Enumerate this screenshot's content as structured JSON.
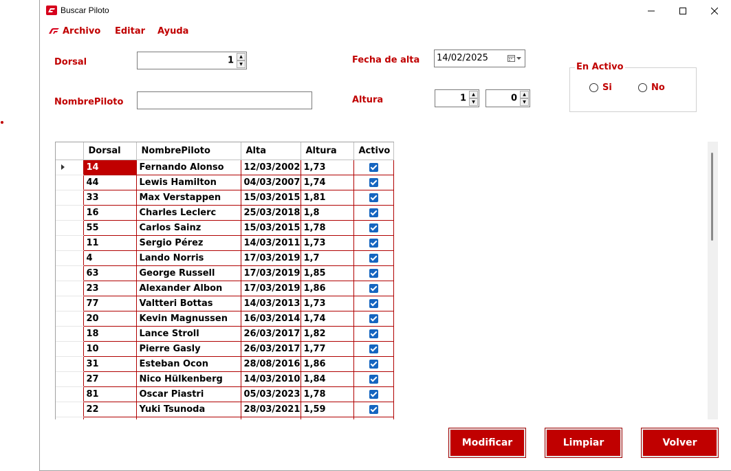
{
  "window": {
    "title": "Buscar Piloto"
  },
  "menu": {
    "archivo": "Archivo",
    "editar": "Editar",
    "ayuda": "Ayuda"
  },
  "form": {
    "dorsal_label": "Dorsal",
    "dorsal_value": "1",
    "nombre_label": "NombrePiloto",
    "nombre_value": "",
    "fecha_label": "Fecha de alta",
    "fecha_value": "14/02/2025",
    "altura_label": "Altura",
    "altura_metros": "1",
    "altura_cm": "0",
    "activo_group": "En Activo",
    "activo_si": "Si",
    "activo_no": "No"
  },
  "grid": {
    "columns": [
      "Dorsal",
      "NombrePiloto",
      "Alta",
      "Altura",
      "Activo"
    ],
    "rows": [
      {
        "dorsal": "14",
        "nombre": "Fernando Alonso",
        "alta": "12/03/2002",
        "altura": "1,73",
        "activo": true
      },
      {
        "dorsal": "44",
        "nombre": "Lewis Hamilton",
        "alta": "04/03/2007",
        "altura": "1,74",
        "activo": true
      },
      {
        "dorsal": "33",
        "nombre": "Max Verstappen",
        "alta": "15/03/2015",
        "altura": "1,81",
        "activo": true
      },
      {
        "dorsal": "16",
        "nombre": "Charles Leclerc",
        "alta": "25/03/2018",
        "altura": "1,8",
        "activo": true
      },
      {
        "dorsal": "55",
        "nombre": "Carlos Sainz",
        "alta": "15/03/2015",
        "altura": "1,78",
        "activo": true
      },
      {
        "dorsal": "11",
        "nombre": "Sergio Pérez",
        "alta": "14/03/2011",
        "altura": "1,73",
        "activo": true
      },
      {
        "dorsal": "4",
        "nombre": "Lando Norris",
        "alta": "17/03/2019",
        "altura": "1,7",
        "activo": true
      },
      {
        "dorsal": "63",
        "nombre": "George Russell",
        "alta": "17/03/2019",
        "altura": "1,85",
        "activo": true
      },
      {
        "dorsal": "23",
        "nombre": "Alexander Albon",
        "alta": "17/03/2019",
        "altura": "1,86",
        "activo": true
      },
      {
        "dorsal": "77",
        "nombre": "Valtteri Bottas",
        "alta": "14/03/2013",
        "altura": "1,73",
        "activo": true
      },
      {
        "dorsal": "20",
        "nombre": "Kevin Magnussen",
        "alta": "16/03/2014",
        "altura": "1,74",
        "activo": true
      },
      {
        "dorsal": "18",
        "nombre": "Lance Stroll",
        "alta": "26/03/2017",
        "altura": "1,82",
        "activo": true
      },
      {
        "dorsal": "10",
        "nombre": "Pierre Gasly",
        "alta": "26/03/2017",
        "altura": "1,77",
        "activo": true
      },
      {
        "dorsal": "31",
        "nombre": "Esteban Ocon",
        "alta": "28/08/2016",
        "altura": "1,86",
        "activo": true
      },
      {
        "dorsal": "27",
        "nombre": "Nico Hülkenberg",
        "alta": "14/03/2010",
        "altura": "1,84",
        "activo": true
      },
      {
        "dorsal": "81",
        "nombre": "Oscar Piastri",
        "alta": "05/03/2023",
        "altura": "1,78",
        "activo": true
      },
      {
        "dorsal": "22",
        "nombre": "Yuki Tsunoda",
        "alta": "28/03/2021",
        "altura": "1,59",
        "activo": true
      },
      {
        "dorsal": "",
        "nombre": "",
        "alta": "",
        "altura": "",
        "activo": true
      }
    ]
  },
  "buttons": {
    "modificar": "Modificar",
    "limpiar": "Limpiar",
    "volver": "Volver"
  },
  "colors": {
    "accent": "#c00000",
    "checkbox": "#1565c0"
  }
}
